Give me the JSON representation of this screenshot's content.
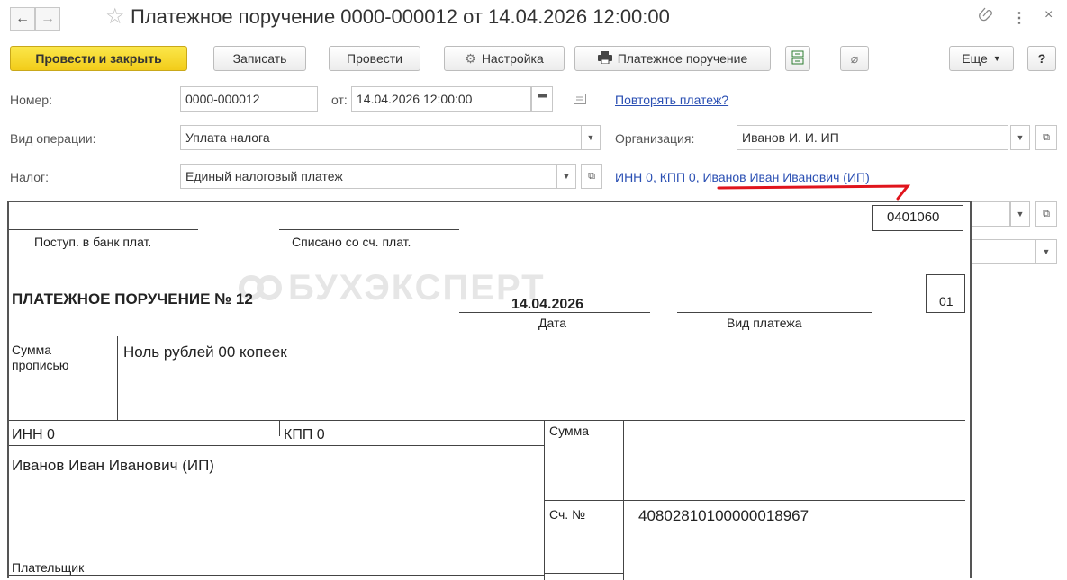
{
  "window": {
    "title": "Платежное поручение 0000-000012 от 14.04.2026 12:00:00",
    "more_icon": "⋮",
    "close_icon": "×"
  },
  "toolbar": {
    "post_close": "Провести и закрыть",
    "save": "Записать",
    "post": "Провести",
    "settings": "Настройка",
    "print": "Платежное поручение",
    "more": "Еще",
    "help": "?"
  },
  "form": {
    "number_label": "Номер:",
    "number_value": "0000-000012",
    "date_label": "от:",
    "date_value": "14.04.2026 12:00:00",
    "repeat_link": "Повторять платеж?",
    "operation_label": "Вид операции:",
    "operation_value": "Уплата налога",
    "org_label": "Организация:",
    "org_value": "Иванов И. И. ИП",
    "tax_label": "Налог:",
    "tax_value": "Единый налоговый платеж",
    "payer_link": "ИНН 0, КПП 0, Иванов Иван Иванович (ИП)"
  },
  "document": {
    "form_code": "0401060",
    "received_label": "Поступ. в банк плат.",
    "debited_label": "Списано со сч. плат.",
    "heading": "ПЛАТЕЖНОЕ ПОРУЧЕНИЕ № 12",
    "date": "14.04.2026",
    "date_caption": "Дата",
    "payment_type_caption": "Вид платежа",
    "status_code": "01",
    "sum_words_label": "Сумма прописью",
    "sum_words_value": "Ноль рублей 00 копеек",
    "inn": "ИНН 0",
    "kpp": "КПП 0",
    "sum_label": "Сумма",
    "payer_name": "Иванов Иван Иванович (ИП)",
    "account_label": "Сч. №",
    "account_value": "40802810100000018967",
    "payer_label": "Плательщик",
    "watermark": "БУХЭКСПЕРТ"
  },
  "colors": {
    "primary_button": "#f5d327",
    "link": "#2a4fb3",
    "annotation_red": "#e0141c"
  }
}
